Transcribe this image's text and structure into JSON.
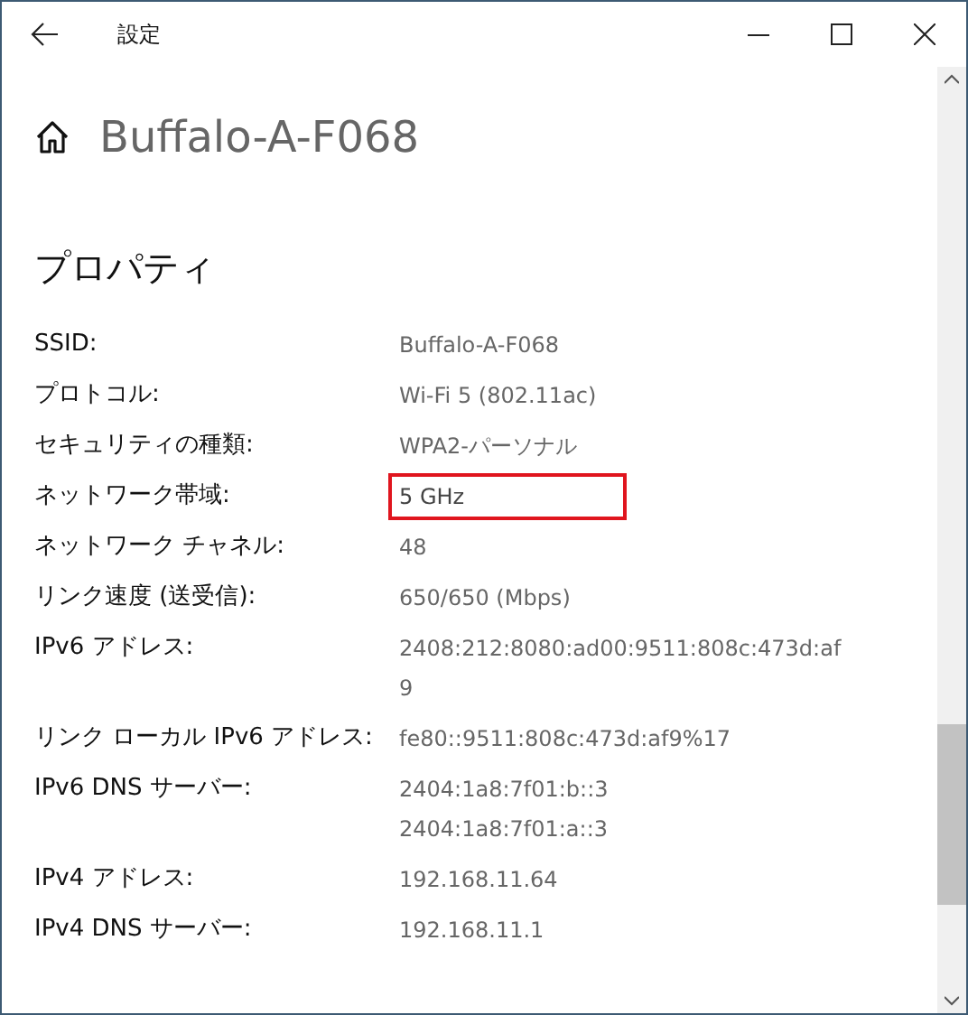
{
  "window": {
    "title": "設定"
  },
  "header": {
    "network_name": "Buffalo-A-F068"
  },
  "section": {
    "title": "プロパティ"
  },
  "properties": [
    {
      "label": "SSID:",
      "values": [
        "Buffalo-A-F068"
      ],
      "highlighted": false
    },
    {
      "label": "プロトコル:",
      "values": [
        "Wi-Fi 5 (802.11ac)"
      ],
      "highlighted": false
    },
    {
      "label": "セキュリティの種類:",
      "values": [
        "WPA2-パーソナル"
      ],
      "highlighted": false
    },
    {
      "label": "ネットワーク帯域:",
      "values": [
        "5 GHz"
      ],
      "highlighted": true
    },
    {
      "label": "ネットワーク チャネル:",
      "values": [
        "48"
      ],
      "highlighted": false
    },
    {
      "label": "リンク速度 (送受信):",
      "values": [
        "650/650 (Mbps)"
      ],
      "highlighted": false
    },
    {
      "label": "IPv6 アドレス:",
      "values": [
        "2408:212:8080:ad00:9511:808c:473d:af",
        "9"
      ],
      "highlighted": false
    },
    {
      "label": "リンク ローカル IPv6 アドレス:",
      "values": [
        "fe80::9511:808c:473d:af9%17"
      ],
      "highlighted": false
    },
    {
      "label": "IPv6 DNS サーバー:",
      "values": [
        "2404:1a8:7f01:b::3",
        "2404:1a8:7f01:a::3"
      ],
      "highlighted": false
    },
    {
      "label": "IPv4 アドレス:",
      "values": [
        "192.168.11.64"
      ],
      "highlighted": false
    },
    {
      "label": "IPv4 DNS サーバー:",
      "values": [
        "192.168.11.1"
      ],
      "highlighted": false
    }
  ]
}
